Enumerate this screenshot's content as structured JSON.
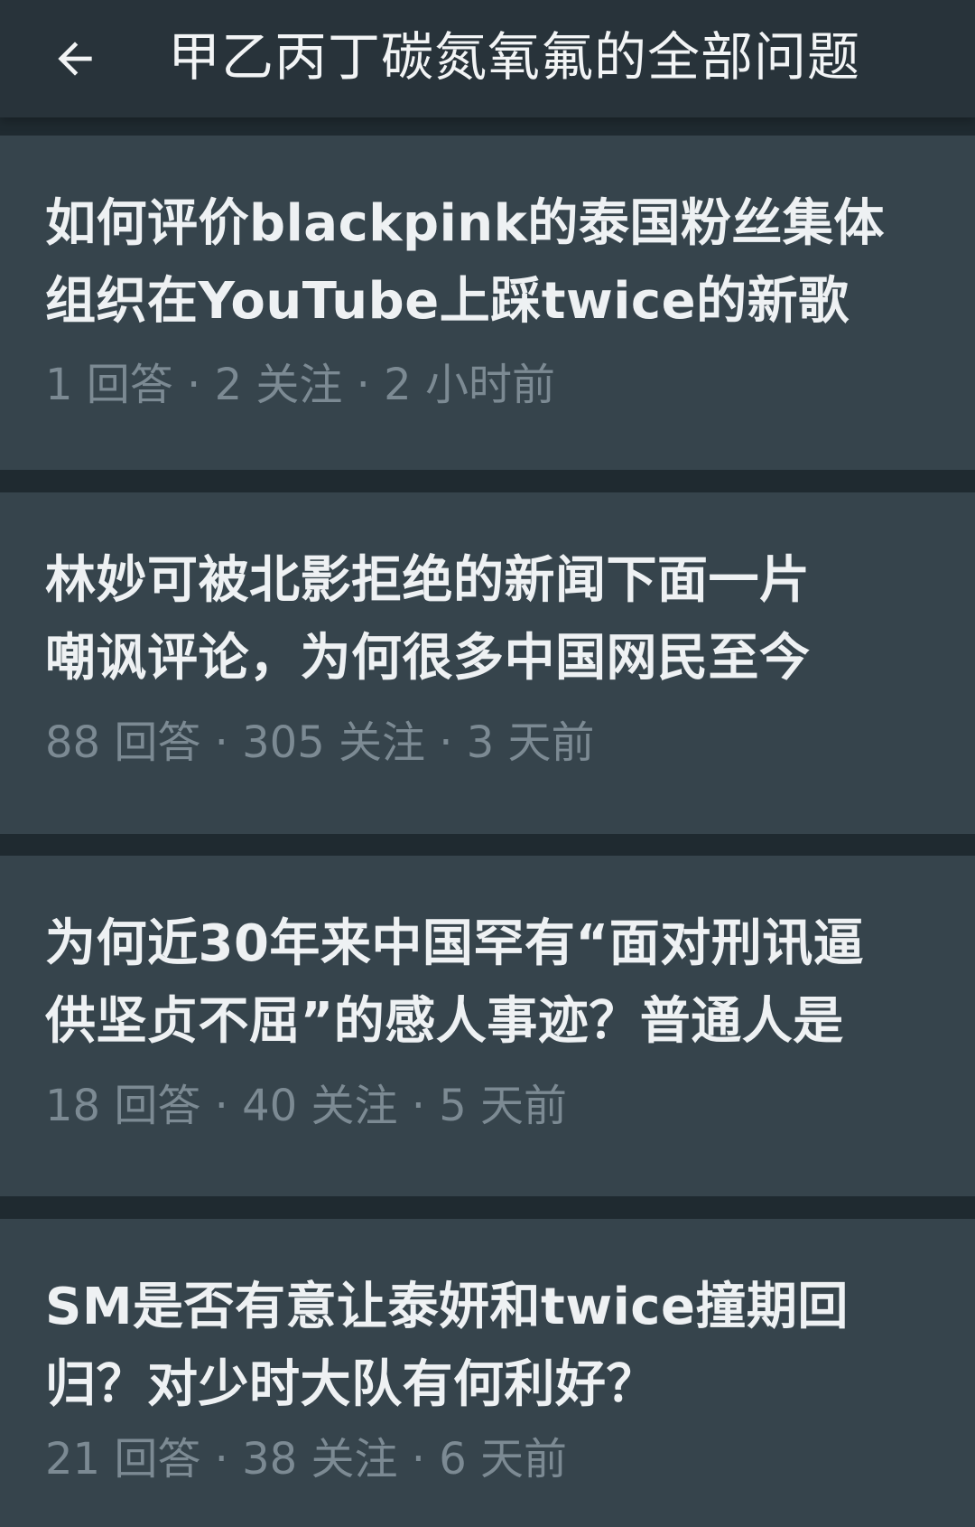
{
  "header": {
    "back_icon": "arrow-left-icon",
    "title": "甲乙丙丁碳氮氧氟的全部问题"
  },
  "questions": [
    {
      "title_lines": [
        "如何评价blackpink的泰国粉丝集体",
        "组织在YouTube上踩twice的新歌"
      ],
      "meta": "1 回答 · 2 关注 · 2 小时前"
    },
    {
      "title_lines": [
        "林妙可被北影拒绝的新闻下面一片",
        "嘲讽评论，为何很多中国网民至今"
      ],
      "meta": "88 回答 · 305 关注 · 3 天前"
    },
    {
      "title_lines": [
        "为何近30年来中国罕有“面对刑讯逼",
        "供坚贞不屈”的感人事迹？普通人是"
      ],
      "meta": "18 回答 · 40 关注 · 5 天前"
    },
    {
      "title_lines": [
        "SM是否有意让泰妍和twice撞期回",
        "归？对少时大队有何利好？"
      ],
      "meta": "21 回答 · 38 关注 · 6 天前"
    }
  ],
  "colors": {
    "background": "#1f2a30",
    "topbar": "#28333a",
    "card": "#36444c",
    "title_text": "#eef1f3",
    "meta_text": "#7c8a93"
  }
}
